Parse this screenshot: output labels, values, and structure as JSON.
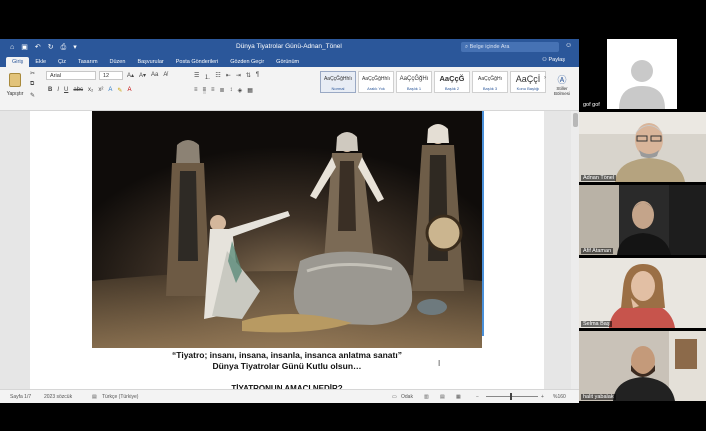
{
  "window": {
    "title": "Dünya Tiyatrolar Günü-Adnan_Tönel",
    "search_placeholder": "Belge içinde Ara"
  },
  "tabs": [
    {
      "label": "Giriş",
      "active": true
    },
    {
      "label": "Ekle"
    },
    {
      "label": "Çiz"
    },
    {
      "label": "Tasarım"
    },
    {
      "label": "Düzen"
    },
    {
      "label": "Başvurular"
    },
    {
      "label": "Posta Gönderileri"
    },
    {
      "label": "Gözden Geçir"
    },
    {
      "label": "Görünüm"
    }
  ],
  "share_label": "Paylaş",
  "ribbon": {
    "paste_label": "Yapıştır",
    "font_name": "Arial",
    "font_size": "12",
    "styles": [
      {
        "sample": "AaÇçĞğHhIı",
        "name": "Normal"
      },
      {
        "sample": "AaÇçĞğHhIı",
        "name": "Aralık Yok"
      },
      {
        "sample": "AaÇçĞğHı",
        "name": "Başlık 1"
      },
      {
        "sample": "AaÇçĞ",
        "name": "Başlık 2"
      },
      {
        "sample": "AaÇçĞğHı",
        "name": "Başlık 3"
      },
      {
        "sample": "AaÇçİ",
        "name": "Konu Başlığı"
      }
    ],
    "styles_pane_label": "Stiller Bölmesi"
  },
  "document": {
    "quote": "“Tiyatro; insanı, insana, insanla, insanca anlatma sanatı”",
    "line2": "Dünya Tiyatrolar Günü Kutlu olsun…",
    "heading": "TİYATRONUN AMACI NEDİR?"
  },
  "status": {
    "page": "Sayfa 1/7",
    "words": "2023 sözcük",
    "language": "Türkçe (Türkiye)",
    "focus": "Odak",
    "zoom": "%160"
  },
  "participants": [
    {
      "name": "gof gof"
    },
    {
      "name": "Adnan Tönel"
    },
    {
      "name": "Afif Ataman"
    },
    {
      "name": "Selma Baş"
    },
    {
      "name": "halit yabalak"
    }
  ],
  "colors": {
    "word_blue": "#2b579a",
    "page_bg": "#ffffff",
    "meeting_bg": "#000000"
  }
}
